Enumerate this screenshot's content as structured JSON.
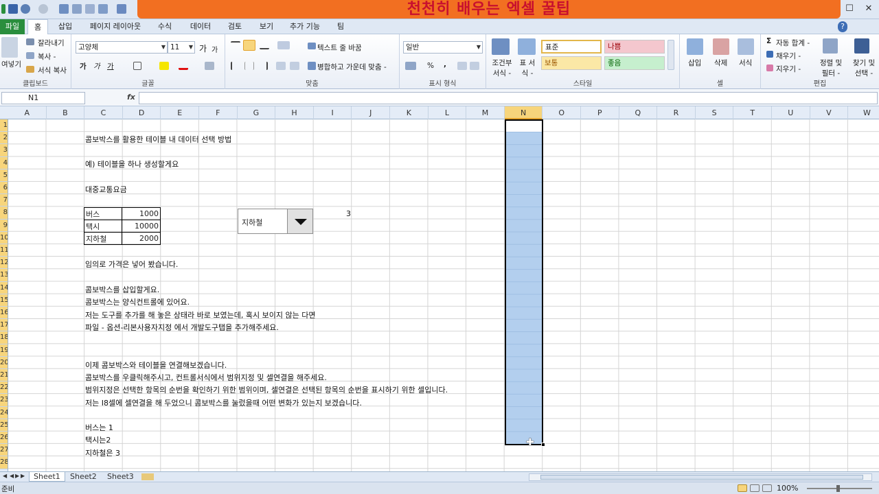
{
  "banner": {
    "text": "천천히 배우는 엑셀 꿀팁"
  },
  "window": {
    "minimize": "—",
    "maximize": "☐",
    "close": "✕"
  },
  "tabs": [
    "파일",
    "홈",
    "삽입",
    "페이지 레이아웃",
    "수식",
    "데이터",
    "검토",
    "보기",
    "추가 기능",
    "팀"
  ],
  "ribbon": {
    "clipboard": {
      "paste": "여넣기",
      "cut": "잘라내기",
      "copy": "복사 -",
      "format_painter": "서식 복사",
      "label": "클립보드"
    },
    "font": {
      "family": "고양체",
      "size": "11",
      "bold": "가",
      "italic": "가",
      "underline": "가",
      "grow": "가",
      "shrink": "가",
      "label": "글꼴"
    },
    "align": {
      "wrap": "텍스트 줄 바꿈",
      "merge": "병합하고 가운데 맞춤 -",
      "label": "맞춤"
    },
    "number": {
      "format": "일반",
      "percent": "%",
      "comma": ",",
      "label": "표시 형식"
    },
    "styles": {
      "conditional": "조건부 서식 -",
      "table": "표 서식 -",
      "normal": "표준",
      "bad": "나쁨",
      "neutral": "보통",
      "good": "좋음",
      "label": "스타일"
    },
    "cells": {
      "insert": "삽입",
      "delete": "삭제",
      "format": "서식",
      "label": "셀"
    },
    "editing": {
      "autosum": "자동 합계 -",
      "fill": "채우기 -",
      "clear": "지우기 -",
      "sort": "정렬 및 필터 -",
      "find": "찾기 및 선택 -",
      "label": "편집"
    }
  },
  "formula_bar": {
    "name_box": "N1",
    "fx": "fx",
    "formula": ""
  },
  "columns": [
    "A",
    "B",
    "C",
    "D",
    "E",
    "F",
    "G",
    "H",
    "I",
    "J",
    "K",
    "L",
    "M",
    "N",
    "O",
    "P",
    "Q",
    "R",
    "S",
    "T",
    "U",
    "V",
    "W"
  ],
  "selected_column": "N",
  "rows": [
    "1",
    "2",
    "3",
    "4",
    "5",
    "6",
    "7",
    "8",
    "9",
    "10",
    "11",
    "12",
    "13",
    "14",
    "15",
    "16",
    "17",
    "18",
    "19",
    "20",
    "21",
    "22",
    "23",
    "24",
    "25",
    "26",
    "27",
    "28"
  ],
  "content": {
    "title": "콤보박스를 활용한 테이블 내 데이터 선택 방법",
    "example": "예) 테이블을 하나 생성할게요",
    "table_title": "대중교통요금",
    "table": [
      {
        "name": "버스",
        "price": "1000"
      },
      {
        "name": "택시",
        "price": "10000"
      },
      {
        "name": "지하철",
        "price": "2000"
      }
    ],
    "combo_value": "지하철",
    "linked_cell": "3",
    "note1": "임의로 가격은 넣어 봤습니다.",
    "p1": "콤보박스를 삽입할게요.",
    "p2": "콤보박스는 양식컨트롤에 있어요.",
    "p3": "저는 도구를 추가를 해 놓은 상태라 바로 보였는데, 혹시 보이지 않는 다면",
    "p4": "파일 - 옵션-리본사용자지정 에서 개발도구탭을 추가해주세요.",
    "q1": "이제 콤보박스와 테이블을 연결해보겠습니다.",
    "q2": "콤보박스를 우클릭해주시고, 컨트롤서식에서 범위지정 및 셀연결을 해주세요.",
    "q3": "범위지정은 선택한 항목의 순번을 확인하기 위한 범위이며, 셀연결은 선택된 항목의 순번을 표시하기 위한 셀입니다.",
    "q4": "저는 I8셀에 셀연결을 해 두었으니 콤보박스를 눌렀을때 어떤 변화가 있는지 보겠습니다.",
    "r1": "버스는 1",
    "r2": "택시는2",
    "r3": "지하철은 3"
  },
  "sheets": [
    "Sheet1",
    "Sheet2",
    "Sheet3"
  ],
  "active_sheet": "Sheet1",
  "status": {
    "left": "준비",
    "zoom": "100%"
  }
}
